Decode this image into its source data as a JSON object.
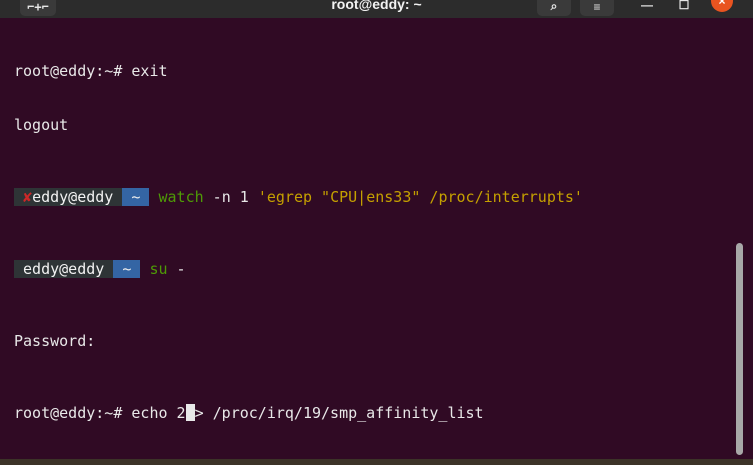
{
  "window": {
    "title": "root@eddy: ~",
    "new_tab_glyph": "⌐+⌐",
    "search_glyph": "⌕",
    "menu_glyph": "≡",
    "minimize_glyph": "—",
    "maximize_glyph": "☐",
    "close_glyph": "×"
  },
  "terminal": {
    "line1": "root@eddy:~# exit",
    "line2": "logout",
    "line3": {
      "error_mark": "✘",
      "user_host": "eddy@eddy",
      "sep1": "",
      "dir": " ~ ",
      "sep2": "",
      "command": "watch",
      "args": " -n 1 ",
      "quoted": "'egrep \"CPU|ens33\" /proc/interrupts'"
    },
    "line4": {
      "user_host": "eddy@eddy",
      "sep1": "",
      "dir": " ~ ",
      "sep2": "",
      "command": "su",
      "args": " -"
    },
    "line5": "Password:",
    "line6": {
      "prompt": "root@eddy:~# echo 2",
      "after_cursor": "> /proc/irq/19/smp_affinity_list"
    }
  },
  "colors": {
    "terminal_bg": "#300a24",
    "prompt_segment_bg": "#2e3436",
    "dir_segment_bg": "#3465a4",
    "command_green": "#4e9a06",
    "quoted_yellow": "#c4a000",
    "error_red": "#cc2828",
    "close_button": "#e95420"
  }
}
